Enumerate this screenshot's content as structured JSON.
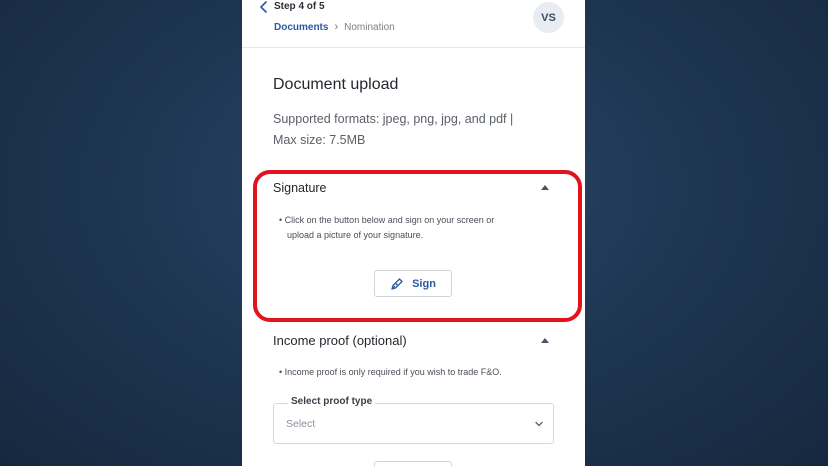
{
  "header": {
    "step": "Step 4 of 5",
    "breadcrumb_link": "Documents",
    "breadcrumb_separator": "›",
    "breadcrumb_current": "Nomination",
    "avatar_initials": "VS",
    "back_icon": "chevron-left-icon"
  },
  "main": {
    "title": "Document upload",
    "formats_line1": "Supported formats: jpeg, png, jpg, and pdf |",
    "formats_line2": "Max size: 7.5MB"
  },
  "signature": {
    "title": "Signature",
    "caret_icon": "chevron-up-icon",
    "instruction_line1": "• Click on the button below and sign on your screen or",
    "instruction_line2": "  upload a picture of your signature.",
    "button_label": "Sign",
    "button_icon": "pen-icon",
    "highlight_color": "#e0141c"
  },
  "income": {
    "title": "Income proof (optional)",
    "caret_icon": "chevron-up-icon",
    "instruction": "• Income proof is only required if you wish to trade F&O.",
    "select_label": "Select proof type",
    "select_placeholder": "Select",
    "select_icon": "chevron-down-icon"
  },
  "colors": {
    "accent": "#2c5aa0",
    "background": "#1d3450"
  }
}
